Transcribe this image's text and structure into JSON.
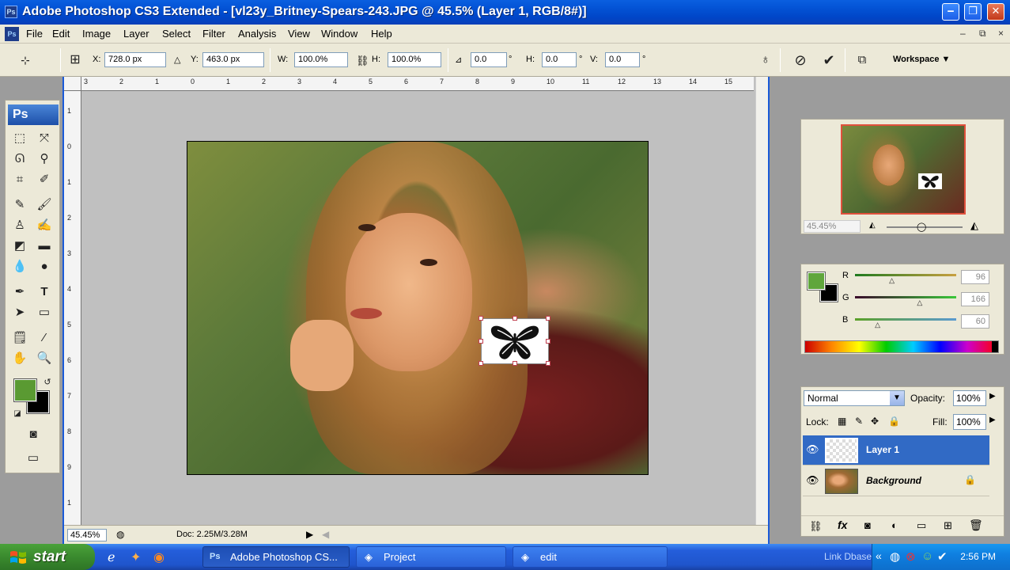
{
  "window": {
    "app_logo": "Ps",
    "title": "Adobe Photoshop CS3 Extended - [vl23y_Britney-Spears-243.JPG @ 45.5% (Layer 1, RGB/8#)]",
    "controls": [
      "minimize-icon",
      "restore-icon",
      "close-icon"
    ]
  },
  "menu": {
    "items": [
      "File",
      "Edit",
      "Image",
      "Layer",
      "Select",
      "Filter",
      "Analysis",
      "View",
      "Window",
      "Help"
    ],
    "doc_controls": [
      "–",
      "⧉",
      "×"
    ]
  },
  "options": {
    "x_label": "X:",
    "x_value": "728.0 px",
    "y_label": "Y:",
    "y_value": "463.0 px",
    "w_label": "W:",
    "w_value": "100.0%",
    "h_label": "H:",
    "h_value": "100.0%",
    "rot_value": "0.0",
    "rot_unit": "°",
    "hskew_label": "H:",
    "hskew_value": "0.0",
    "vskew_label": "V:",
    "vskew_value": "0.0",
    "deg": "°",
    "workspace_label": "Workspace ▼"
  },
  "toolbox": {
    "header": "Ps"
  },
  "ruler": {
    "top_labels": [
      "3",
      "2",
      "1",
      "0",
      "1",
      "2",
      "3",
      "4",
      "5",
      "6",
      "7",
      "8",
      "9",
      "10",
      "11",
      "12",
      "13",
      "14",
      "15"
    ],
    "left_labels": [
      "1",
      "0",
      "1",
      "2",
      "3",
      "4",
      "5",
      "6",
      "7",
      "8",
      "9",
      "1"
    ]
  },
  "document": {
    "zoom": "45.45%",
    "info": "Doc: 2.25M/3.28M",
    "image_alt": "Photo of a woman lying in grass resting her chin on her hand, with a butterfly graphic layer selected in a transform box"
  },
  "navigator": {
    "zoom": "45.45%"
  },
  "color": {
    "channels": [
      {
        "label": "R",
        "value": "96",
        "fraction": 0.376,
        "track": "linear-gradient(90deg,#1f7a1f,#c8a040)"
      },
      {
        "label": "G",
        "value": "166",
        "fraction": 0.651,
        "track": "linear-gradient(90deg,#3a0a2a,#3ac83a)"
      },
      {
        "label": "B",
        "value": "60",
        "fraction": 0.235,
        "track": "linear-gradient(90deg,#5aa028,#5a9ad0)"
      }
    ],
    "foreground": "#60a63c",
    "background": "#000000"
  },
  "layers": {
    "blend_mode": "Normal",
    "opacity_label": "Opacity:",
    "opacity_value": "100%",
    "lock_label": "Lock:",
    "fill_label": "Fill:",
    "fill_value": "100%",
    "rows": [
      {
        "name": "Layer 1",
        "active": true
      },
      {
        "name": "Background",
        "active": false,
        "locked": true
      }
    ]
  },
  "taskbar": {
    "start": "start",
    "items": [
      "Adobe Photoshop CS...",
      "Project",
      "edit"
    ],
    "tray_label": "Link Dbase",
    "clock": "2:56 PM"
  },
  "colors": {
    "titlebar": "#0454d6",
    "selection": "#316ac5",
    "taskbar": "#245edb",
    "start": "#3a8a2e"
  }
}
